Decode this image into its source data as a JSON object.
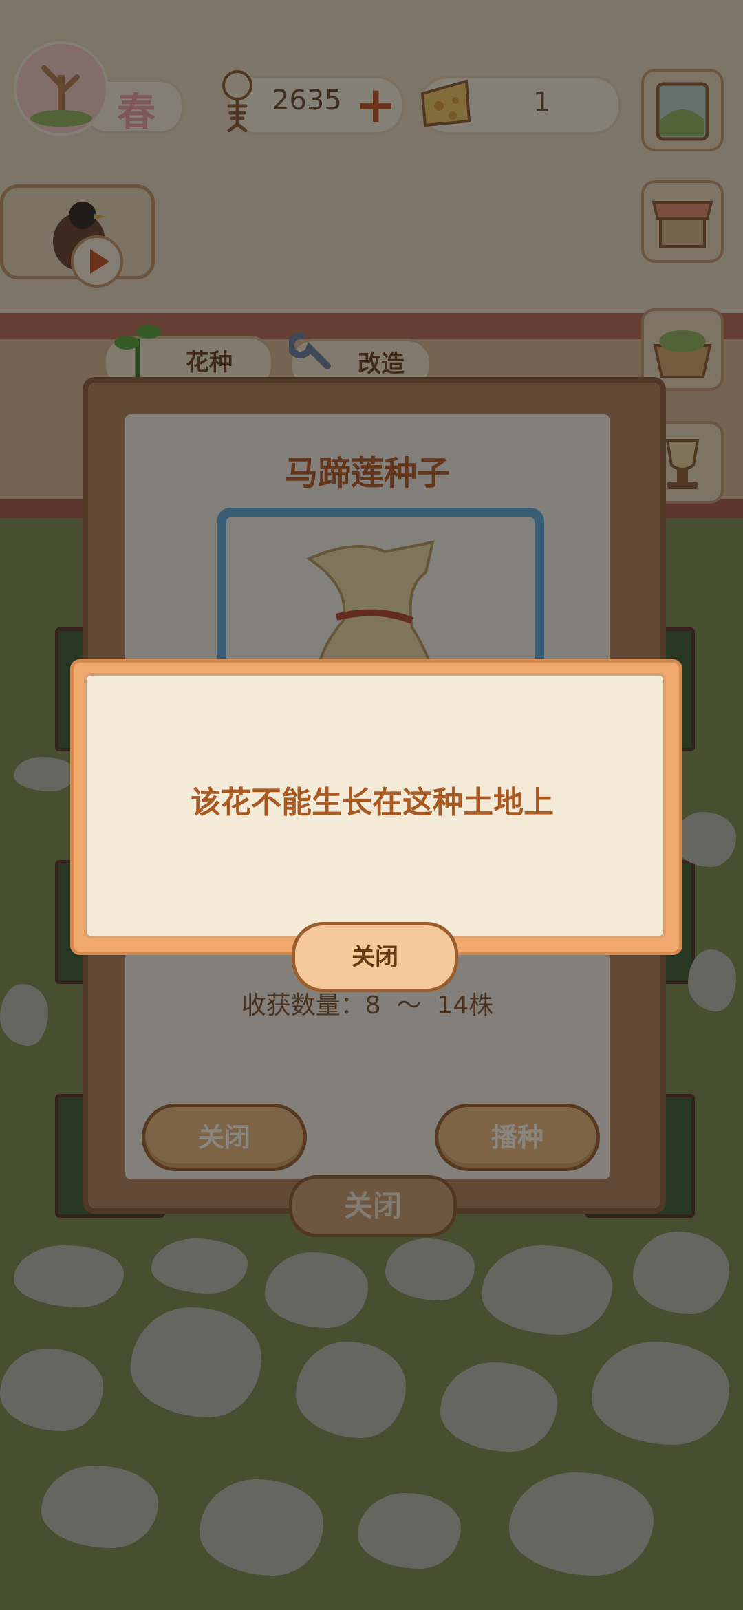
{
  "hud": {
    "season_label": "春",
    "fish_count": "2635",
    "cheese_count": "1"
  },
  "tabs": {
    "flower_seeds": "花种",
    "renovate": "改造"
  },
  "seed_panel": {
    "title": "马蹄莲种子",
    "yield_text": "收获数量：8  ～  14株",
    "close_label": "关闭",
    "sow_label": "播种",
    "bottom_close_label": "关闭"
  },
  "alert": {
    "message": "该花不能生长在这种土地上",
    "close_label": "关闭"
  },
  "colors": {
    "accent_orange": "#f1a86d",
    "title_brown": "#b35720",
    "frame_blue": "#5ea7d6"
  }
}
